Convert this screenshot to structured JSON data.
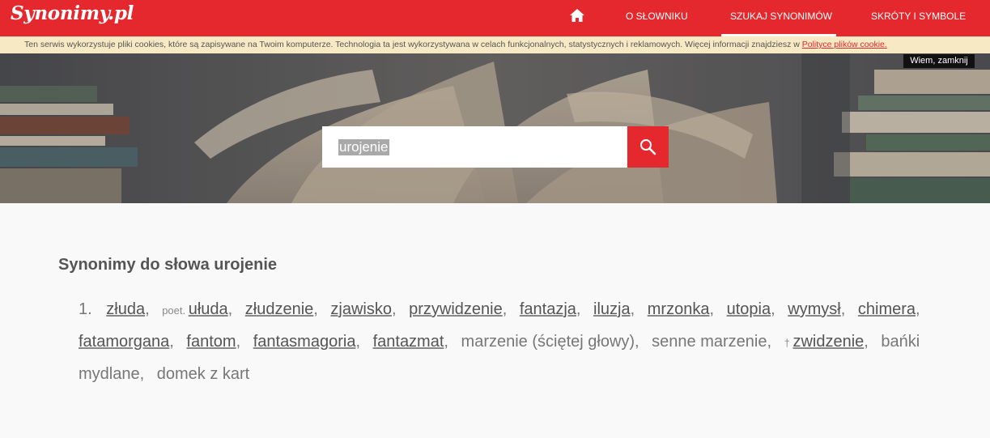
{
  "site": {
    "logo": "Synonimy.pl"
  },
  "nav": {
    "home_icon": "home-icon",
    "items": [
      {
        "label": "O słowniku",
        "active": false
      },
      {
        "label": "Szukaj synonimów",
        "active": true
      },
      {
        "label": "Skróty i symbole",
        "active": false
      }
    ]
  },
  "cookie": {
    "text": "Ten serwis wykorzystuje pliki cookies, które są zapisywane na Twoim komputerze. Technologia ta jest wykorzystywana w celach funkcjonalnych, statystycznych i reklamowych. Więcej informacji znajdziesz w ",
    "link": "Polityce plików cookie.",
    "close": "Wiem, zamknij"
  },
  "search": {
    "value": "urojenie",
    "button_icon": "search-icon"
  },
  "result": {
    "title": "Synonimy do słowa urojenie",
    "number": "1.",
    "items": [
      {
        "text": "złuda",
        "link": true
      },
      {
        "mark": "poet.",
        "text": "ułuda",
        "link": true
      },
      {
        "text": "złudzenie",
        "link": true
      },
      {
        "text": "zjawisko",
        "link": true
      },
      {
        "text": "przywidzenie",
        "link": true
      },
      {
        "text": "fantazja",
        "link": true
      },
      {
        "text": "iluzja",
        "link": true
      },
      {
        "text": "mrzonka",
        "link": true
      },
      {
        "text": "utopia",
        "link": true
      },
      {
        "text": "wymysł",
        "link": true
      },
      {
        "text": "chimera",
        "link": true
      },
      {
        "text": "fatamorgana",
        "link": true
      },
      {
        "text": "fantom",
        "link": true
      },
      {
        "text": "fantasmagoria",
        "link": true
      },
      {
        "text": "fantazmat",
        "link": true
      },
      {
        "text": "marzenie (ściętej głowy)",
        "link": false
      },
      {
        "text": "senne marzenie",
        "link": false
      },
      {
        "mark": "†",
        "text": "zwidzenie",
        "link": true
      },
      {
        "text": "bańki mydlane",
        "link": false
      },
      {
        "text": "domek z kart",
        "link": false
      }
    ]
  },
  "colors": {
    "brand_red": "#e5282d",
    "cookie_bg": "#f7e9c4",
    "page_bg": "#f9f9f9"
  }
}
